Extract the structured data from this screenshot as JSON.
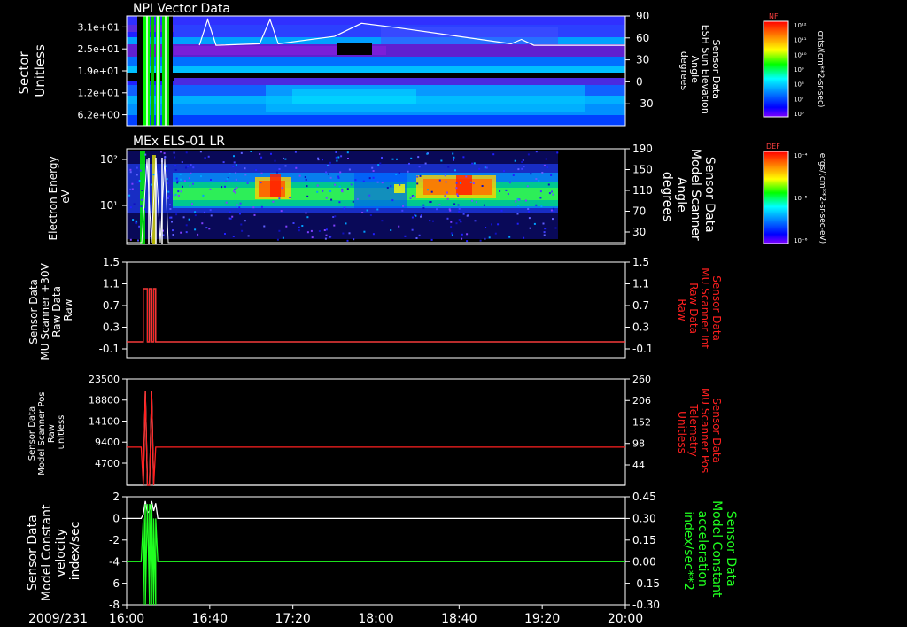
{
  "date_label": "2009/231",
  "x_ticks": [
    "16:00",
    "16:40",
    "17:20",
    "18:00",
    "18:40",
    "19:20",
    "20:00"
  ],
  "colorbars": [
    {
      "title": "NF",
      "unit": "cnts/(cm**2-sr-sec)",
      "labels": [
        "10¹²",
        "10¹¹",
        "10¹⁰",
        "10⁹",
        "10⁸",
        "10⁷",
        "10⁶"
      ]
    },
    {
      "title": "DEF",
      "unit": "ergs/(cm**2-sr-sec-eV)",
      "labels": [
        "10⁻⁴",
        "10⁻⁵",
        "10⁻⁶"
      ]
    }
  ],
  "chart_data": [
    {
      "type": "heatmap",
      "title": "NPI Vector Data",
      "ylabel": "Sector\nUnitless",
      "y_tick_labels": [
        "3.1e+01",
        "2.5e+01",
        "1.9e+01",
        "1.2e+01",
        "6.2e+00"
      ],
      "y2label": "Sensor Data\nESH Sun Elevation\nAngle\ndegrees",
      "y2_ticks": [
        90,
        60,
        30,
        0,
        -30
      ],
      "y2lim": [
        -60,
        90
      ],
      "x_range": [
        "16:00",
        "20:00"
      ],
      "overlay_line": {
        "axis": "right",
        "color": "#ffffff",
        "x": [
          "16:35",
          "16:39",
          "16:43",
          "17:04",
          "17:09",
          "17:13",
          "17:40",
          "17:53",
          "18:10",
          "18:40",
          "19:05",
          "19:10",
          "19:16",
          "20:00"
        ],
        "y": [
          50,
          85,
          50,
          52,
          85,
          52,
          62,
          80,
          74,
          62,
          52,
          58,
          50,
          50
        ]
      }
    },
    {
      "type": "heatmap",
      "title": "MEx ELS-01 LR",
      "ylabel": "Electron Energy\neV",
      "y_scale": "log",
      "y_tick_labels": [
        "10²",
        "10¹"
      ],
      "y2label": "Sensor Data\nModel Scanner\nAngle\ndegrees",
      "y2_ticks": [
        190,
        150,
        110,
        70,
        30
      ],
      "x_range": [
        "16:00",
        "19:20"
      ]
    },
    {
      "type": "line",
      "ylabel": "Sensor Data\nMU Scanner +30V\nRaw Data\nRaw",
      "y_ticks": [
        "1.5",
        "1.1",
        "0.7",
        "0.3",
        "-0.1"
      ],
      "ylim": [
        -0.3,
        1.5
      ],
      "y2label": "Sensor Data\nMU Scanner Int\nRaw Data\nRaw",
      "y2_ticks": [
        "1.5",
        "1.1",
        "0.7",
        "0.3",
        "-0.1"
      ],
      "series": [
        {
          "axis": "left",
          "color": "#ffffff",
          "x": [
            "16:00",
            "16:08",
            "16:08",
            "16:10",
            "16:10",
            "16:11",
            "16:11",
            "16:12",
            "16:12",
            "16:13",
            "16:13",
            "16:14",
            "16:14",
            "16:15",
            "16:15",
            "20:00"
          ],
          "y": [
            0,
            0,
            1,
            1,
            0,
            0,
            1,
            1,
            0,
            0,
            1,
            1,
            0,
            0,
            0,
            0
          ]
        },
        {
          "axis": "right",
          "color": "#ff2020",
          "x": [
            "16:00",
            "16:08",
            "16:08",
            "16:10",
            "16:10",
            "16:11",
            "16:11",
            "16:12",
            "16:12",
            "16:13",
            "16:13",
            "16:14",
            "16:14",
            "16:15",
            "16:15",
            "20:00"
          ],
          "y": [
            0,
            0,
            1,
            1,
            0,
            0,
            1,
            1,
            0,
            0,
            1,
            1,
            0,
            0,
            0,
            0
          ]
        }
      ]
    },
    {
      "type": "line",
      "ylabel": "Sensor Data\nModel Scanner Pos\nRaw\nunitless",
      "y_ticks": [
        23500,
        18800,
        14100,
        9400,
        4700
      ],
      "ylim": [
        0,
        23500
      ],
      "y2label": "Sensor Data\nMU Scanner Pos\nTelemetry\nUnitless",
      "y2_ticks": [
        260,
        206,
        152,
        98,
        44
      ],
      "y2lim": [
        0,
        260
      ],
      "series": [
        {
          "axis": "left",
          "color": "#ffffff",
          "x": [
            "16:00",
            "16:08",
            "16:09",
            "16:10",
            "16:11",
            "16:12",
            "16:13",
            "16:14",
            "16:15",
            "20:00"
          ],
          "y": [
            0,
            0,
            21200,
            0,
            0,
            21200,
            0,
            0,
            0,
            0
          ]
        },
        {
          "axis": "right",
          "color": "#ff2020",
          "x": [
            "16:00",
            "16:07",
            "16:08",
            "16:09",
            "16:10",
            "16:11",
            "16:12",
            "16:13",
            "16:14",
            "16:15",
            "20:00"
          ],
          "y": [
            95,
            95,
            0,
            234,
            0,
            0,
            234,
            0,
            95,
            95,
            95
          ]
        }
      ]
    },
    {
      "type": "line",
      "ylabel": "Sensor Data\nModel Constant\nvelocity\nindex/sec",
      "y_ticks": [
        2,
        0,
        -2,
        -4,
        -6,
        -8
      ],
      "ylim": [
        -8,
        2
      ],
      "y2label": "Sensor Data\nModel Constant\nacceleration\nindex/sec**2",
      "y2_ticks": [
        "0.45",
        "0.30",
        "0.15",
        "0.00",
        "-0.15",
        "-0.30"
      ],
      "y2lim": [
        -0.3,
        0.45
      ],
      "series": [
        {
          "axis": "left",
          "color": "#ffffff",
          "x": [
            "16:00",
            "16:07",
            "16:08",
            "16:09",
            "16:10",
            "16:11",
            "16:12",
            "16:13",
            "16:14",
            "16:15",
            "20:00"
          ],
          "y": [
            0,
            0,
            0.4,
            1.6,
            0.5,
            0.7,
            1.6,
            0.7,
            1.4,
            0,
            0
          ]
        },
        {
          "axis": "right",
          "color": "#20ff20",
          "x": [
            "16:00",
            "16:07",
            "16:08",
            "16:08",
            "16:09",
            "16:09",
            "16:10",
            "16:11",
            "16:11",
            "16:12",
            "16:12",
            "16:13",
            "16:13",
            "16:14",
            "16:14",
            "16:15",
            "20:00"
          ],
          "y": [
            0,
            0,
            0.3,
            -0.3,
            0.4,
            -0.3,
            0.4,
            -0.3,
            0.4,
            -0.3,
            0.4,
            -0.3,
            0.3,
            -0.3,
            0.3,
            0,
            0
          ]
        }
      ]
    }
  ]
}
